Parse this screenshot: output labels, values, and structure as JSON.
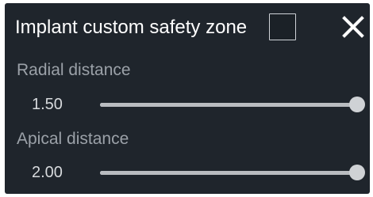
{
  "panel": {
    "title": "Implant custom safety zone",
    "checkbox_checked": false,
    "close_icon": "close-icon"
  },
  "sliders": [
    {
      "label": "Radial distance",
      "value": "1.50",
      "level_fraction": 1.0
    },
    {
      "label": "Apical distance",
      "value": "2.00",
      "level_fraction": 1.0
    }
  ],
  "colors": {
    "panel_bg": "#1f252c",
    "title_text": "#ffffff",
    "label_text": "#9ba1a8",
    "value_text": "#d7dadd",
    "slider_track": "#c4c7cb",
    "slider_thumb": "#cfd2d5"
  }
}
